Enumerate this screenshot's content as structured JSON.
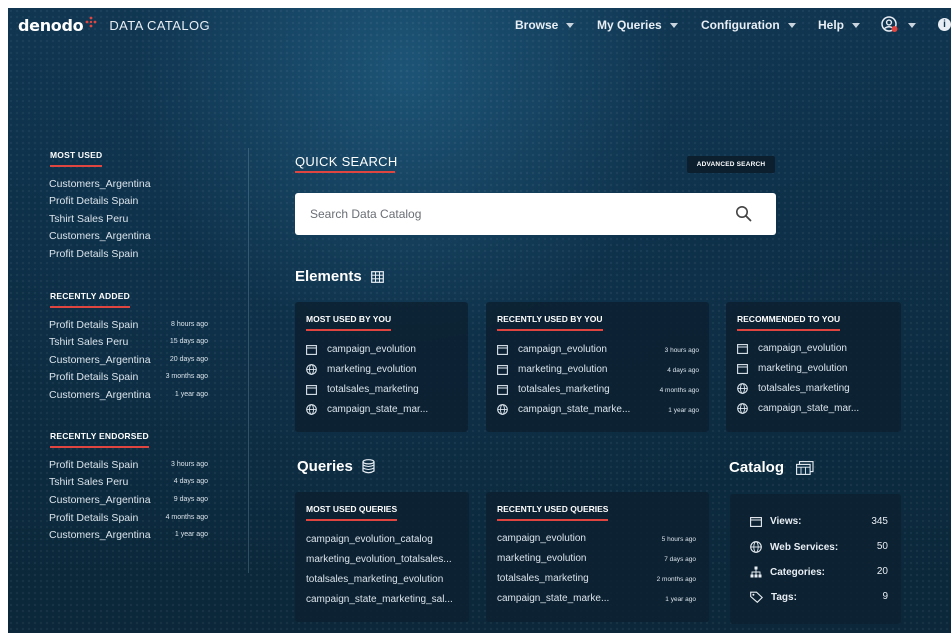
{
  "brand": {
    "name": "denodo",
    "product": "DATA CATALOG"
  },
  "nav": {
    "browse": "Browse",
    "my_queries": "My Queries",
    "configuration": "Configuration",
    "help": "Help",
    "info_glyph": "i"
  },
  "sidebar": {
    "most_used": {
      "title": "MOST USED",
      "items": [
        "Customers_Argentina",
        "Profit Details Spain",
        "Tshirt Sales Peru",
        "Customers_Argentina",
        "Profit Details Spain"
      ]
    },
    "recently_added": {
      "title": "RECENTLY ADDED",
      "items": [
        {
          "label": "Profit Details Spain",
          "time": "8 hours ago"
        },
        {
          "label": "Tshirt Sales Peru",
          "time": "15 days ago"
        },
        {
          "label": "Customers_Argentina",
          "time": "20 days ago"
        },
        {
          "label": "Profit Details Spain",
          "time": "3 months ago"
        },
        {
          "label": "Customers_Argentina",
          "time": "1 year ago"
        }
      ]
    },
    "recently_endorsed": {
      "title": "RECENTLY ENDORSED",
      "items": [
        {
          "label": "Profit Details Spain",
          "time": "3 hours ago"
        },
        {
          "label": "Tshirt Sales Peru",
          "time": "4 days ago"
        },
        {
          "label": "Customers_Argentina",
          "time": "9 days ago"
        },
        {
          "label": "Profit Details Spain",
          "time": "4 months ago"
        },
        {
          "label": "Customers_Argentina",
          "time": "1 year ago"
        }
      ]
    }
  },
  "quick_search": {
    "title": "QUICK SEARCH",
    "advanced": "ADVANCED SEARCH",
    "placeholder": "Search Data Catalog"
  },
  "elements": {
    "title": "Elements",
    "most_used_by_you": {
      "title": "MOST USED BY YOU",
      "items": [
        {
          "label": "campaign_evolution",
          "icon": "view-icon"
        },
        {
          "label": "marketing_evolution",
          "icon": "globe-icon"
        },
        {
          "label": "totalsales_marketing",
          "icon": "view-icon"
        },
        {
          "label": "campaign_state_mar...",
          "icon": "globe-icon"
        }
      ]
    },
    "recently_used_by_you": {
      "title": "RECENTLY USED BY YOU",
      "items": [
        {
          "label": "campaign_evolution",
          "time": "3 hours ago",
          "icon": "view-icon"
        },
        {
          "label": "marketing_evolution",
          "time": "4 days ago",
          "icon": "view-icon"
        },
        {
          "label": "totalsales_marketing",
          "time": "4 months ago",
          "icon": "view-icon"
        },
        {
          "label": "campaign_state_marke...",
          "time": "1 year ago",
          "icon": "globe-icon"
        }
      ]
    },
    "recommended_to_you": {
      "title": "RECOMMENDED TO YOU",
      "items": [
        {
          "label": "campaign_evolution",
          "icon": "view-icon"
        },
        {
          "label": "marketing_evolution",
          "icon": "view-icon"
        },
        {
          "label": "totalsales_marketing",
          "icon": "globe-icon"
        },
        {
          "label": "campaign_state_mar...",
          "icon": "globe-icon"
        }
      ]
    }
  },
  "queries": {
    "title": "Queries",
    "most_used": {
      "title": "MOST USED QUERIES",
      "items": [
        "campaign_evolution_catalog",
        "marketing_evolution_totalsales...",
        "totalsales_marketing_evolution",
        "campaign_state_marketing_sal..."
      ]
    },
    "recently_used": {
      "title": "RECENTLY USED QUERIES",
      "items": [
        {
          "label": "campaign_evolution",
          "time": "5 hours ago"
        },
        {
          "label": "marketing_evolution",
          "time": "7 days ago"
        },
        {
          "label": "totalsales_marketing",
          "time": "2 months ago"
        },
        {
          "label": "campaign_state_marke...",
          "time": "1 year ago"
        }
      ]
    }
  },
  "catalog": {
    "title": "Catalog",
    "stats": [
      {
        "label": "Views:",
        "value": "345"
      },
      {
        "label": "Web Services:",
        "value": "50"
      },
      {
        "label": "Categories:",
        "value": "20"
      },
      {
        "label": "Tags:",
        "value": "9"
      }
    ]
  },
  "colors": {
    "accent": "#e0453f",
    "background": "#0f3550",
    "card": "#0c2030"
  }
}
